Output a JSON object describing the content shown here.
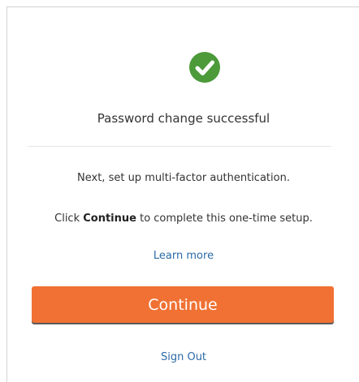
{
  "colors": {
    "success": "#4c9a3a",
    "primary_button": "#f07133",
    "link": "#2b6aa6",
    "text": "#333333",
    "divider": "#e6e6e6"
  },
  "status": {
    "icon": "check-circle-icon",
    "title": "Password change successful"
  },
  "message": {
    "line1": "Next, set up multi-factor authentication.",
    "line2_prefix": "Click ",
    "line2_bold": "Continue",
    "line2_suffix": " to complete this one-time setup."
  },
  "links": {
    "learn_more": "Learn more",
    "sign_out": "Sign Out"
  },
  "actions": {
    "continue_label": "Continue"
  }
}
